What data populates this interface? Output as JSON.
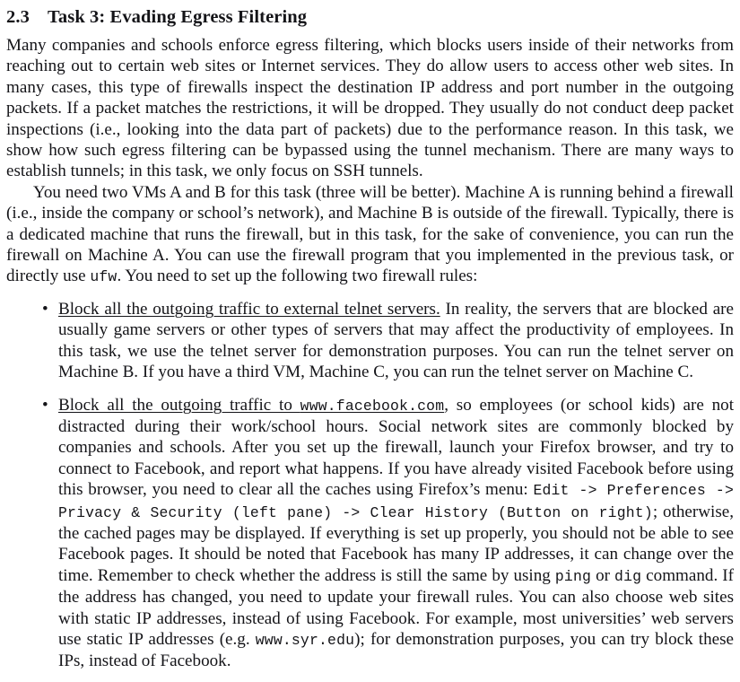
{
  "document": {
    "section": {
      "number": "2.3",
      "title": "Task 3: Evading Egress Filtering"
    },
    "paragraphs": [
      {
        "id": "p1",
        "indent": false,
        "text": "Many companies and schools enforce egress filtering, which blocks users inside of their networks from reaching out to certain web sites or Internet services. They do allow users to access other web sites. In many cases, this type of firewalls inspect the destination IP address and port number in the outgoing packets. If a packet matches the restrictions, it will be dropped. They usually do not conduct deep packet inspections (i.e., looking into the data part of packets) due to the performance reason. In this task, we show how such egress filtering can be bypassed using the tunnel mechanism. There are many ways to establish tunnels; in this task, we only focus on SSH tunnels."
      }
    ],
    "paragraph2": {
      "part1": "You need two VMs A and B for this task (three will be better). Machine A is running behind a firewall (i.e., inside the company or school’s network), and Machine B is outside of the firewall. Typically, there is a dedicated machine that runs the firewall, but in this task, for the sake of convenience, you can run the firewall on Machine A. You can use the firewall program that you implemented in the previous task, or directly use ",
      "code_ufw": "ufw",
      "part2": ". You need to set up the following two firewall rules:"
    },
    "bullets": [
      {
        "marker": "•",
        "lead_in": "Block all the outgoing traffic to external telnet servers.",
        "rest": " In reality, the servers that are blocked are usually game servers or other types of servers that may affect the productivity of employees. In this task, we use the telnet server for demonstration purposes. You can run the telnet server on Machine B. If you have a third VM, Machine C, you can run the telnet server on Machine C."
      }
    ],
    "bullet2": {
      "marker": "•",
      "lead_in_prefix": "Block all the outgoing traffic to ",
      "lead_in_code": "www.facebook.com",
      "seg1": ", so employees (or school kids) are not distracted during their work/school hours. Social network sites are commonly blocked by companies and schools. After you set up the firewall, launch your Firefox browser, and try to connect to Facebook, and report what happens. If you have already visited Facebook before using this browser, you need to clear all the caches using Firefox’s menu: ",
      "menu_path_code": "Edit -> Preferences -> Privacy & Security (left pane) -> Clear History (Button on right)",
      "seg2": "; otherwise, the cached pages may be displayed. If everything is set up properly, you should not be able to see Facebook pages. It should be noted that Facebook has many IP addresses, it can change over the time. Remember to check whether the address is still the same by using ",
      "code_ping": "ping",
      "seg3": " or ",
      "code_dig": "dig",
      "seg4": " command. If the address has changed, you need to update your firewall rules. You can also choose web sites with static IP addresses, instead of using Facebook. For example, most universities’ web servers use static IP addresses (e.g. ",
      "code_url": "www.syr.edu",
      "seg5": "); for demonstration purposes, you can try block these IPs, instead of Facebook."
    },
    "colors": {
      "page_background": "#ffffff",
      "text": "#141418"
    }
  }
}
